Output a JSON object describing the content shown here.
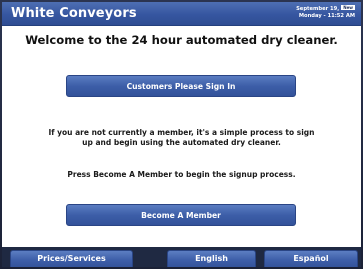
{
  "header": {
    "brand": "White Conveyors",
    "date": "September 19,",
    "badge": "New",
    "time": "Monday - 11:52 AM"
  },
  "main": {
    "welcome": "Welcome to the 24 hour automated dry cleaner.",
    "signin_label": "Customers Please Sign In",
    "info_line1": "If you are not currently a member, it's a simple process to sign",
    "info_line2": "up and begin using the automated dry cleaner.",
    "press_text": "Press Become A Member to begin the signup process.",
    "member_label": "Become A Member"
  },
  "footer": {
    "tabs": [
      {
        "label": "Prices/Services"
      },
      {
        "label": "English"
      },
      {
        "label": "Español"
      }
    ]
  },
  "colors": {
    "header_blue": "#3656a0",
    "button_blue": "#3d5ea8",
    "bezel": "#20283f"
  }
}
